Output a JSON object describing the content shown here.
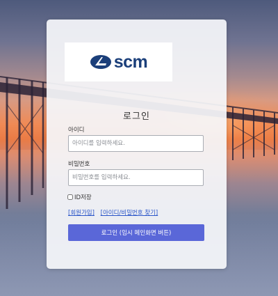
{
  "background": {
    "scene": "pier at sunset over water"
  },
  "logo": {
    "text": "scm",
    "color": "#1b3f7a"
  },
  "form": {
    "title": "로그인",
    "id_label": "아이디",
    "id_placeholder": "아이디를 입력하세요.",
    "password_label": "비밀번호",
    "password_placeholder": "비밀번호를 입력하세요.",
    "remember_label": "ID저장",
    "remember_checked": false
  },
  "links": {
    "signup": "[회원가입]",
    "find": "[아이디/비밀번호 찾기]"
  },
  "login_button": {
    "label": "로그인 (임시 메인화면 버튼)",
    "color": "#5a67d8"
  }
}
